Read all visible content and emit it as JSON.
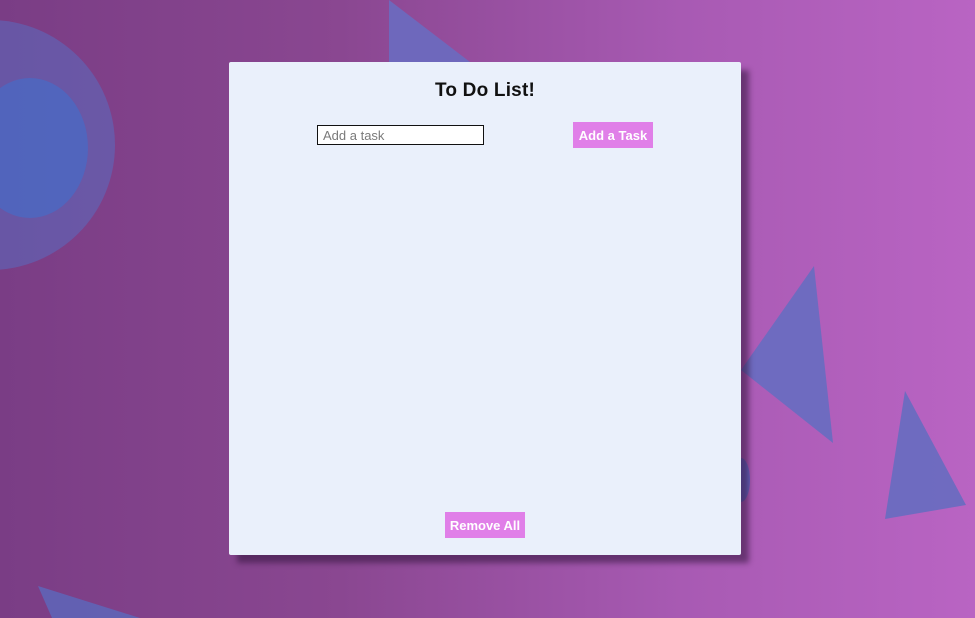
{
  "app": {
    "title": "To Do List!"
  },
  "input": {
    "placeholder": "Add a task",
    "value": ""
  },
  "buttons": {
    "add_label": "Add a Task",
    "remove_all_label": "Remove All"
  },
  "tasks": [],
  "colors": {
    "background_start": "#7a3d85",
    "background_end": "#b964c3",
    "panel": "#eaf0fb",
    "accent_button": "#e07fe8",
    "shape_blue": "#5a6cc0"
  }
}
